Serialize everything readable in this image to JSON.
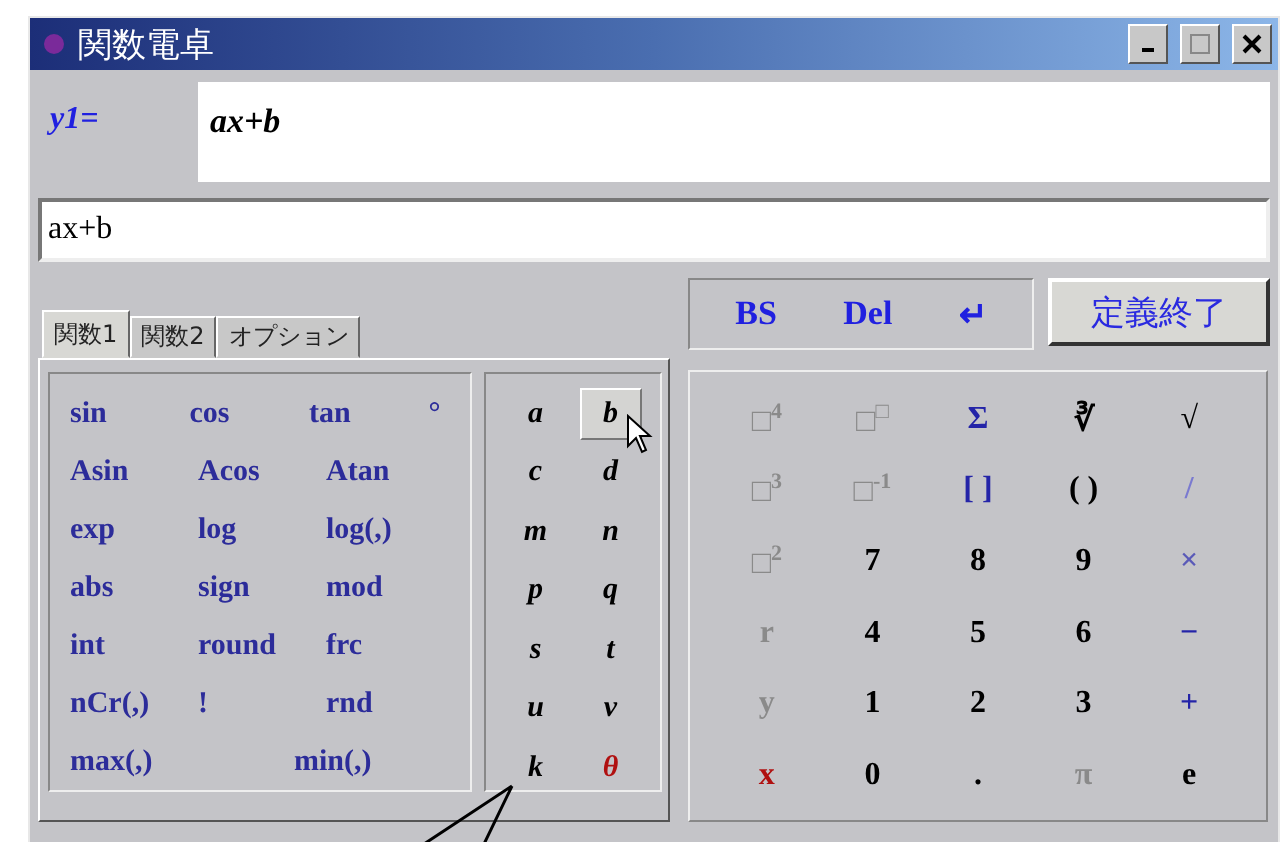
{
  "window": {
    "title": "関数電卓"
  },
  "definition": {
    "label": "y1=",
    "display": "ax+b"
  },
  "input": {
    "value": "ax+b"
  },
  "tabs": [
    {
      "label": "関数1",
      "selected": true
    },
    {
      "label": "関数2",
      "selected": false
    },
    {
      "label": "オプション",
      "selected": false
    }
  ],
  "functions": [
    [
      "sin",
      "cos",
      "tan",
      "°"
    ],
    [
      "Asin",
      "Acos",
      "Atan"
    ],
    [
      "exp",
      "log",
      "log(,)"
    ],
    [
      "abs",
      "sign",
      "mod"
    ],
    [
      "int",
      "round",
      "frc"
    ],
    [
      "nCr(,)",
      "!",
      "rnd"
    ],
    [
      "max(,)",
      "min(,)"
    ]
  ],
  "variables": [
    {
      "label": "a",
      "highlighted": false,
      "color": "#000000"
    },
    {
      "label": "b",
      "highlighted": true,
      "color": "#000000"
    },
    {
      "label": "c",
      "highlighted": false,
      "color": "#000000"
    },
    {
      "label": "d",
      "highlighted": false,
      "color": "#000000"
    },
    {
      "label": "m",
      "highlighted": false,
      "color": "#000000"
    },
    {
      "label": "n",
      "highlighted": false,
      "color": "#000000"
    },
    {
      "label": "p",
      "highlighted": false,
      "color": "#000000"
    },
    {
      "label": "q",
      "highlighted": false,
      "color": "#000000"
    },
    {
      "label": "s",
      "highlighted": false,
      "color": "#000000"
    },
    {
      "label": "t",
      "highlighted": false,
      "color": "#000000"
    },
    {
      "label": "u",
      "highlighted": false,
      "color": "#000000"
    },
    {
      "label": "v",
      "highlighted": false,
      "color": "#000000"
    },
    {
      "label": "k",
      "highlighted": false,
      "color": "#000000"
    },
    {
      "label": "θ",
      "highlighted": false,
      "color": "#b01010"
    }
  ],
  "edit_keys": [
    "BS",
    "Del",
    "↵"
  ],
  "finish_button": "定義終了",
  "keypad": [
    {
      "label": "□$^{4}$",
      "color": "#8a8a8a"
    },
    {
      "label": "□$^{□}$",
      "color": "#8a8a8a"
    },
    {
      "label": "Σ",
      "color": "#2424a8"
    },
    {
      "label": "∛",
      "color": "#000000"
    },
    {
      "label": "√",
      "color": "#000000"
    },
    {
      "label": "□$^{3}$",
      "color": "#8a8a8a"
    },
    {
      "label": "□$^{-1}$",
      "color": "#8a8a8a"
    },
    {
      "label": "[ ]",
      "color": "#2424a8"
    },
    {
      "label": "( )",
      "color": "#000000"
    },
    {
      "label": "/",
      "color": "#7a7ad0"
    },
    {
      "label": "□$^{2}$",
      "color": "#8a8a8a"
    },
    {
      "label": "7",
      "color": "#000000"
    },
    {
      "label": "8",
      "color": "#000000"
    },
    {
      "label": "9",
      "color": "#000000"
    },
    {
      "label": "×",
      "color": "#5a5ab8"
    },
    {
      "label": "r",
      "color": "#8a8a8a"
    },
    {
      "label": "4",
      "color": "#000000"
    },
    {
      "label": "5",
      "color": "#000000"
    },
    {
      "label": "6",
      "color": "#000000"
    },
    {
      "label": "−",
      "color": "#2424a8"
    },
    {
      "label": "y",
      "color": "#8a8a8a"
    },
    {
      "label": "1",
      "color": "#000000"
    },
    {
      "label": "2",
      "color": "#000000"
    },
    {
      "label": "3",
      "color": "#000000"
    },
    {
      "label": "+",
      "color": "#2424a8"
    },
    {
      "label": "x",
      "color": "#b01010"
    },
    {
      "label": "0",
      "color": "#000000"
    },
    {
      "label": ".",
      "color": "#000000"
    },
    {
      "label": "π",
      "color": "#8a8a8a"
    },
    {
      "label": "e",
      "color": "#000000"
    }
  ]
}
